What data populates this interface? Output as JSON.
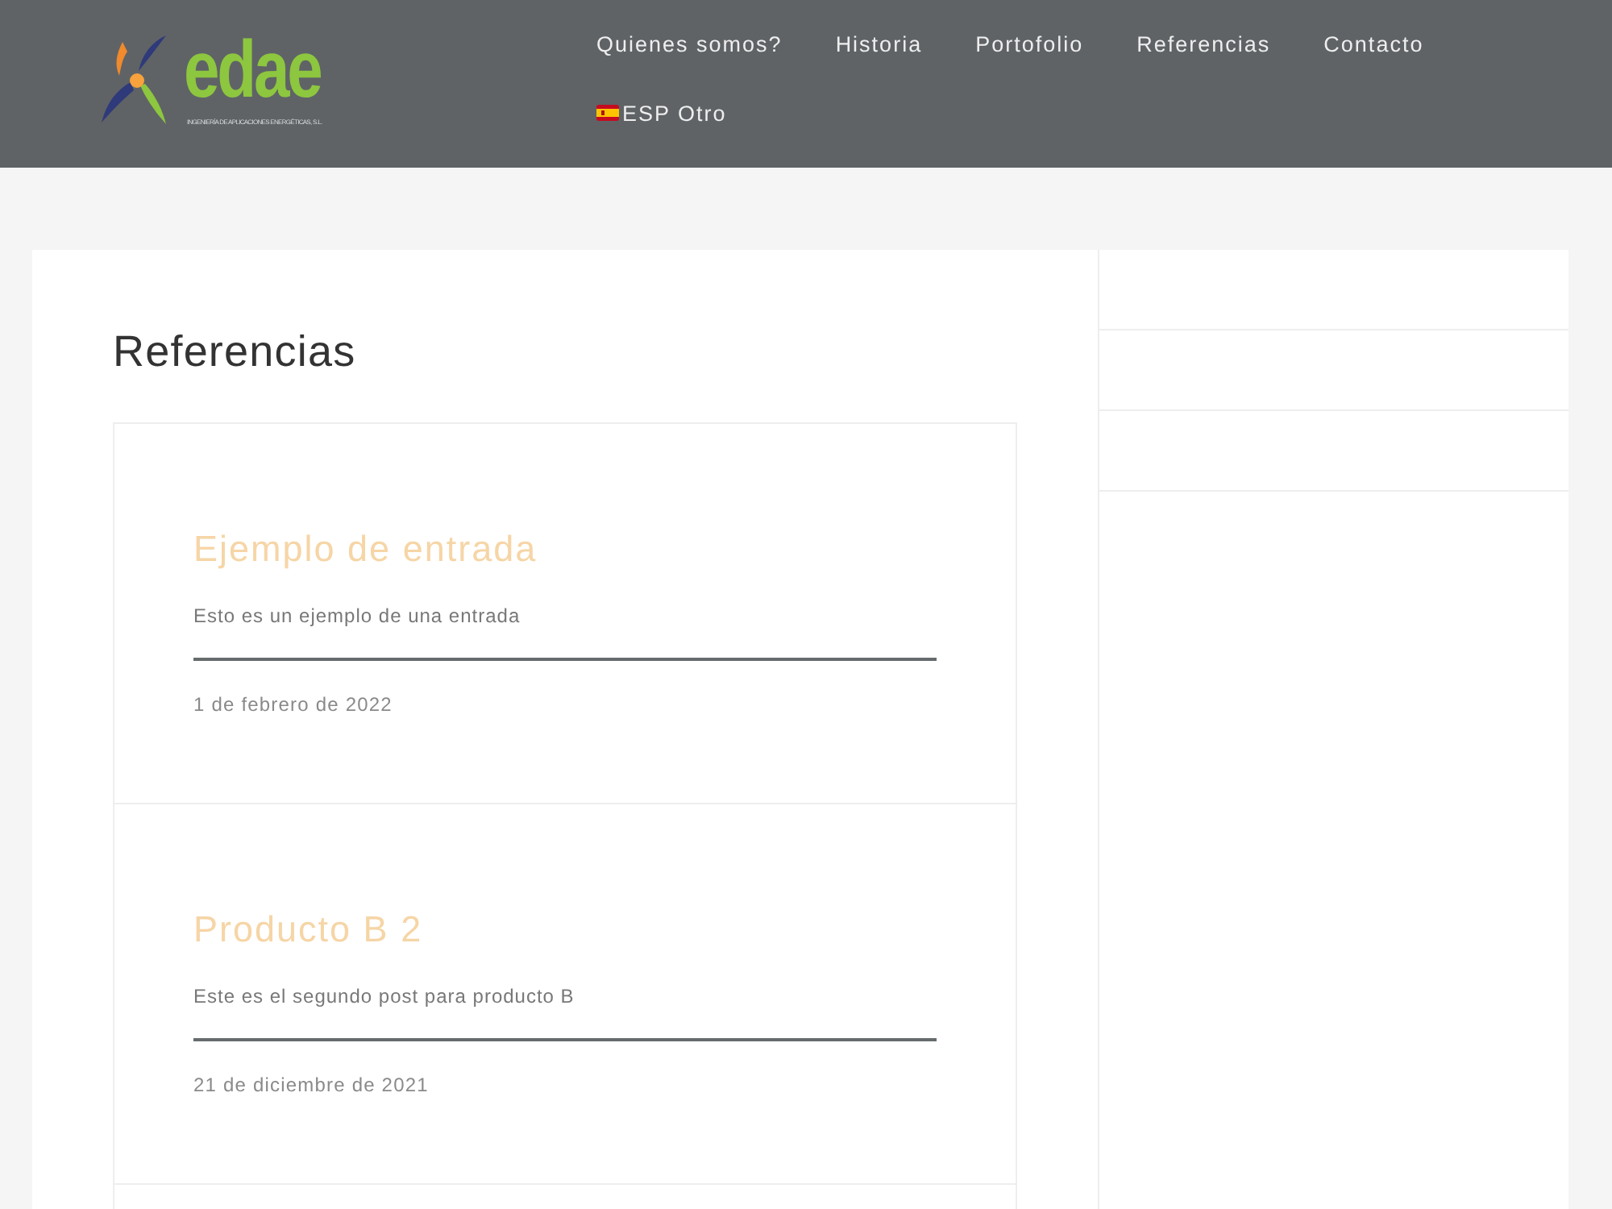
{
  "header": {
    "logo": {
      "wordmark": "edae",
      "tagline": "INGENIERÍA DE APLICACIONES ENERGÉTICAS, S.L."
    },
    "nav": [
      {
        "label": "Quienes somos?",
        "kind": "link"
      },
      {
        "label": "Historia",
        "kind": "link"
      },
      {
        "label": "Portofolio",
        "kind": "link"
      },
      {
        "label": "Referencias",
        "kind": "link"
      },
      {
        "label": "Contacto",
        "kind": "link"
      },
      {
        "label": "ESP Otro",
        "kind": "language"
      }
    ]
  },
  "page": {
    "title": "Referencias"
  },
  "posts": [
    {
      "title": "Ejemplo de entrada",
      "excerpt": "Esto es un ejemplo de una entrada",
      "date": "1 de febrero de 2022"
    },
    {
      "title": "Producto B 2",
      "excerpt": "Este es el segundo post para producto B",
      "date": "21 de diciembre de 2021"
    }
  ]
}
